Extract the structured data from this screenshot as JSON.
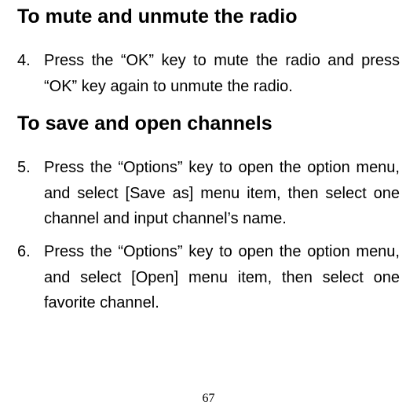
{
  "section1": {
    "heading": "To mute and unmute the radio",
    "items": [
      {
        "num": "4.",
        "text": "Press the “OK” key to mute the radio and press “OK” key again to unmute the radio."
      }
    ]
  },
  "section2": {
    "heading": "To save and open channels",
    "items": [
      {
        "num": "5.",
        "text": "Press the “Options” key to open the option menu, and select [Save as] menu item, then select one channel and input channel’s name."
      },
      {
        "num": "6.",
        "text": "Press the “Options” key to open the option menu, and select [Open] menu item, then select one favorite channel."
      }
    ]
  },
  "page_number": "67"
}
